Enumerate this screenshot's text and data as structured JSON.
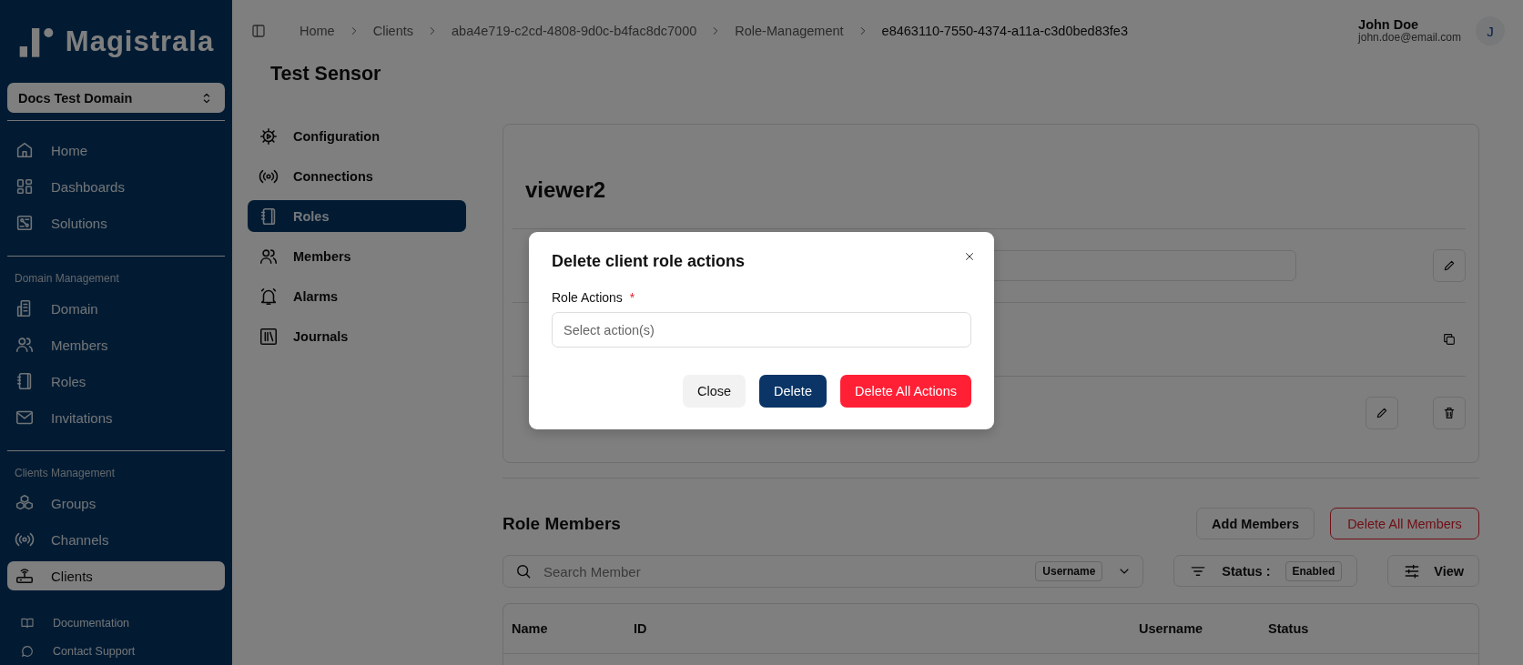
{
  "sidebar": {
    "logo": "Magistrala",
    "domain_selector": "Docs Test Domain",
    "groups": [
      {
        "items": [
          {
            "label": "Home",
            "selected": false
          },
          {
            "label": "Dashboards",
            "selected": false
          },
          {
            "label": "Solutions",
            "selected": false
          }
        ]
      },
      {
        "heading": "Domain Management",
        "items": [
          {
            "label": "Domain",
            "selected": false
          },
          {
            "label": "Members",
            "selected": false
          },
          {
            "label": "Roles",
            "selected": false
          },
          {
            "label": "Invitations",
            "selected": false
          }
        ]
      },
      {
        "heading": "Clients Management",
        "items": [
          {
            "label": "Groups",
            "selected": false
          },
          {
            "label": "Channels",
            "selected": false
          },
          {
            "label": "Clients",
            "selected": true
          }
        ]
      }
    ],
    "footer_links": [
      "Documentation",
      "Contact Support"
    ]
  },
  "topbar": {
    "breadcrumbs": [
      "Home",
      "Clients",
      "aba4e719-c2cd-4808-9d0c-b4fac8dc7000",
      "Role-Management",
      "e8463110-7550-4374-a11a-c3d0bed83fe3"
    ],
    "user": {
      "name": "John Doe",
      "email": "john.doe@email.com",
      "initial": "J"
    }
  },
  "page": {
    "title": "Test Sensor",
    "tabs": [
      {
        "label": "Configuration",
        "selected": false
      },
      {
        "label": "Connections",
        "selected": false
      },
      {
        "label": "Roles",
        "selected": true
      },
      {
        "label": "Members",
        "selected": false
      },
      {
        "label": "Alarms",
        "selected": false
      },
      {
        "label": "Journals",
        "selected": false
      }
    ]
  },
  "role_card": {
    "name": "viewer2"
  },
  "role_members": {
    "title": "Role Members",
    "add_button": "Add Members",
    "delete_all_button": "Delete All Members",
    "search": {
      "placeholder": "Search Member",
      "field_select": "Username"
    },
    "status_filter": {
      "label": "Status :",
      "value": "Enabled"
    },
    "view_button": "View",
    "columns": [
      "Name",
      "ID",
      "Username",
      "Status"
    ]
  },
  "modal": {
    "title": "Delete client role actions",
    "field_label": "Role Actions",
    "required_mark": "*",
    "placeholder": "Select action(s)",
    "buttons": [
      {
        "kind": "secondary",
        "label": "Close"
      },
      {
        "kind": "primary",
        "label": "Delete"
      },
      {
        "kind": "danger",
        "label": "Delete All Actions"
      }
    ]
  }
}
